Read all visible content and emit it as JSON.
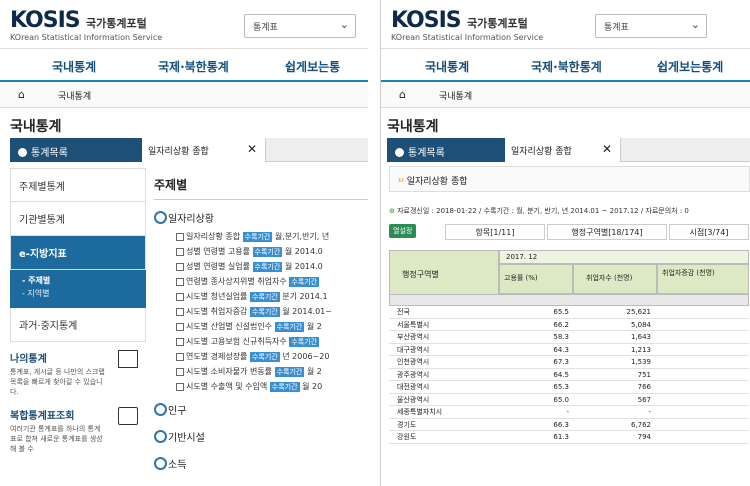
{
  "left": {
    "logo": {
      "mark": "KOSIS",
      "kr": "국가통계포털",
      "en": "KOrean Statistical Information Service"
    },
    "select": "통계표",
    "nav": [
      "국내통계",
      "국제·북한통계",
      "쉽게보는통"
    ],
    "breadcrumb": "국내통계",
    "page_title": "국내통계",
    "tab_dark": "통계목록",
    "tab_open": "일자리상황 종합",
    "side": [
      "주제별통계",
      "기관별통계",
      "e-지방지표",
      "과거·중지통계"
    ],
    "side_sub": [
      "- 주제별",
      "- 지역별"
    ],
    "box1": {
      "title": "나의통계",
      "desc": "통계표, 게시글 등 나만의 스크랩 목록을 빠르게 찾아갈 수 있습니다."
    },
    "box2": {
      "title": "복합통계표조회",
      "desc": "여러기관 통계표를 하나의 통계표로 합쳐 새로운 통계표를 생성해 볼 수"
    },
    "main_head": "주제별",
    "cat1": "일자리상황",
    "items": [
      {
        "t": "일자리상황 종합",
        "m": "월,분기,반기, 년"
      },
      {
        "t": "성별 연령별 고용률",
        "m": "월 2014.0"
      },
      {
        "t": "성별 연령별 실업률",
        "m": "월 2014.0"
      },
      {
        "t": "연령별 종사상지위별 취업자수",
        "m": ""
      },
      {
        "t": "시도별 청년실업률",
        "m": "분기 2014.1"
      },
      {
        "t": "시도별 취업자증감",
        "m": "월 2014.01~"
      },
      {
        "t": "시도별 산업별 신설법인수",
        "m": "월 2"
      },
      {
        "t": "시도별 고용보험 신규취득자수",
        "m": ""
      },
      {
        "t": "연도별 경제성장률",
        "m": "년 2006~20"
      },
      {
        "t": "시도별 소비자물가 변동률",
        "m": "월 2"
      },
      {
        "t": "시도별 수출액 및 수입액",
        "m": "월 20"
      }
    ],
    "tag": "수록기간",
    "cats": [
      "인구",
      "기반시설",
      "소득"
    ]
  },
  "right": {
    "logo": {
      "mark": "KOSIS",
      "kr": "국가통계포털",
      "en": "KOrean Statistical Information Service"
    },
    "select": "통계표",
    "nav": [
      "국내통계",
      "국제·북한통계",
      "쉽게보는통계"
    ],
    "breadcrumb": "국내통계",
    "page_title": "국내통계",
    "tab_dark": "통계목록",
    "tab_open": "일자리상황 종합",
    "panel_title": "일자리상황 종합",
    "info": "자료갱신일 : 2018-01-22 / 수록기간 : 월, 분기, 반기, 년 2014.01 ~ 2017.12 / 자료문의처 : 0",
    "btn": "열설정",
    "ctabs": [
      "항목[1/11]",
      "행정구역별[18/174]",
      "시점[3/74]"
    ],
    "head": {
      "c0": "행정구역별",
      "period": "2017. 12",
      "c1": "고용률 (%)",
      "c2": "취업자수 (천명)",
      "c3": "취업자증감 (천명)"
    },
    "rows": [
      [
        "전국",
        "65.5",
        "25,621"
      ],
      [
        "서울특별시",
        "66.2",
        "5,084"
      ],
      [
        "부산광역시",
        "58.3",
        "1,643"
      ],
      [
        "대구광역시",
        "64.3",
        "1,213"
      ],
      [
        "인천광역시",
        "67.3",
        "1,539"
      ],
      [
        "광주광역시",
        "64.5",
        "751"
      ],
      [
        "대전광역시",
        "65.3",
        "766"
      ],
      [
        "울산광역시",
        "65.0",
        "567"
      ],
      [
        "세종특별자치시",
        "-",
        "-"
      ],
      [
        "경기도",
        "66.3",
        "6,762"
      ],
      [
        "강원도",
        "61.3",
        "794"
      ]
    ]
  }
}
